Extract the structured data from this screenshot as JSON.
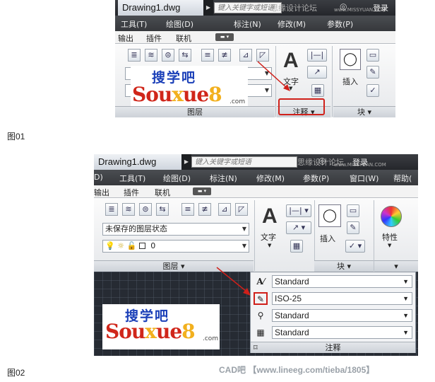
{
  "shot1": {
    "doc_title": "Drawing1.dwg",
    "search_placeholder": "键入关键字或短语",
    "watermark": "思缘设计论坛",
    "watermark_site": "www.MISSYUAN.COM",
    "login": "登录",
    "menu": [
      "工具(T)",
      "绘图(D)",
      "标注(N)",
      "修改(M)",
      "参数(P)"
    ],
    "tabs": [
      "输出",
      "插件",
      "联机"
    ],
    "text_label": "文字",
    "insert_label": "插入",
    "layer_panel_label": "图层",
    "annotation_panel_label": "注释",
    "block_panel_label": "块"
  },
  "shot2": {
    "doc_title": "Drawing1.dwg",
    "search_placeholder": "键入关键字或短语",
    "watermark": "思缘设计论坛",
    "watermark_site": "www.MISSYUAN.COM",
    "login": "登录",
    "menu": [
      "D)",
      "工具(T)",
      "绘图(D)",
      "标注(N)",
      "修改(M)",
      "参数(P)",
      "窗口(W)",
      "帮助("
    ],
    "tabs": [
      "输出",
      "插件",
      "联机"
    ],
    "layer_state": "未保存的图层状态",
    "layer_value": "0",
    "layer_panel_label": "图层",
    "text_label": "文字",
    "insert_label": "插入",
    "properties_label": "特性",
    "block_panel_label": "块",
    "annotation_panel_label": "注释",
    "styles": [
      {
        "icon": "text-style-icon",
        "value": "Standard"
      },
      {
        "icon": "dimension-style-icon",
        "value": "ISO-25"
      },
      {
        "icon": "multileader-style-icon",
        "value": "Standard"
      },
      {
        "icon": "table-style-icon",
        "value": "Standard"
      }
    ]
  },
  "logo": {
    "cn": "搜学吧",
    "en_a": "Sou",
    "en_x": "x",
    "en_b": "ue",
    "en_8": "8",
    "domain": ".com"
  },
  "captions": {
    "fig1": "图01",
    "fig2": "图02"
  },
  "footer_watermark": "CAD吧 【www.lineeg.com/tieba/1805】",
  "colors": {
    "accent_red": "#d0201a",
    "title_dark": "#2d2f33",
    "canvas": "#262b33"
  }
}
